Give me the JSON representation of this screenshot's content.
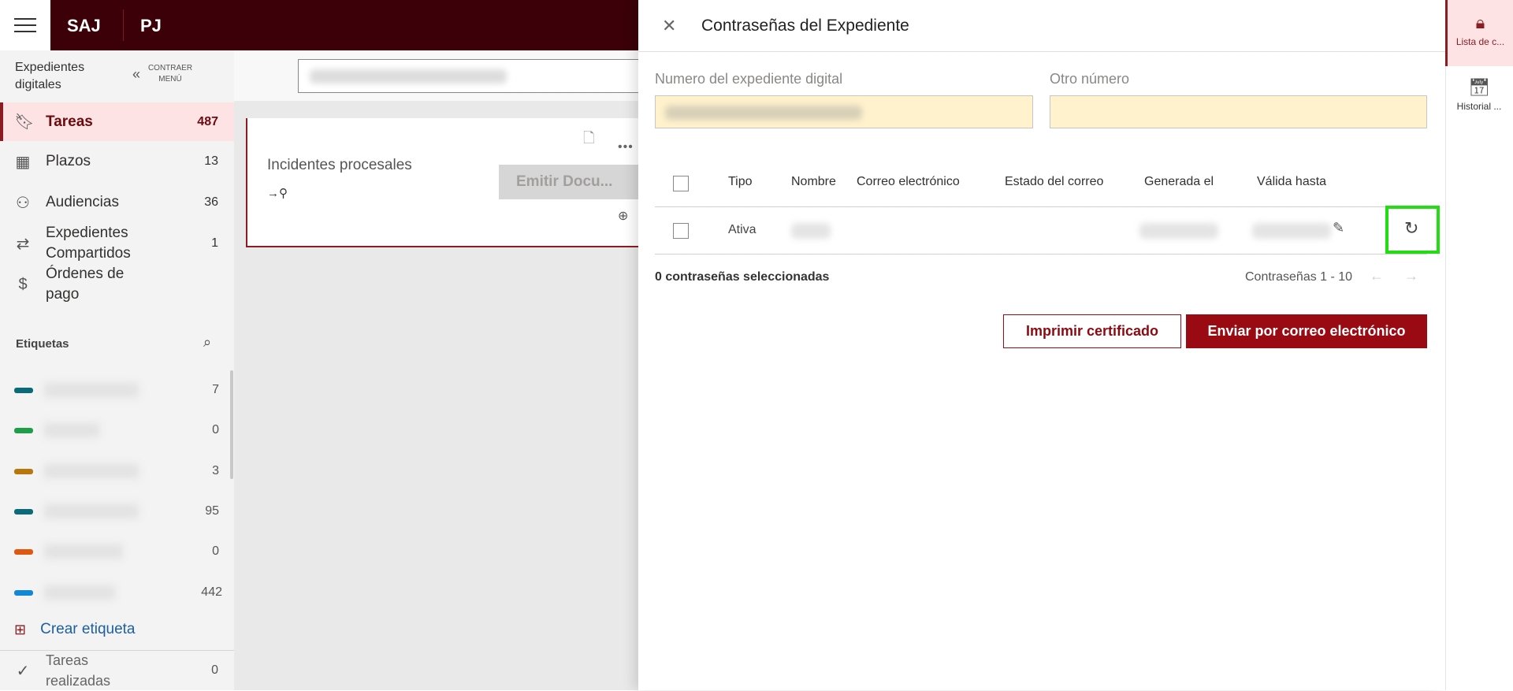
{
  "header": {
    "brand": "SAJ",
    "sub_brand": "PJ"
  },
  "sidebar": {
    "title": "Expedientes digitales",
    "collapse_label": "CONTRAER MENÚ",
    "items": [
      {
        "label": "Tareas",
        "count": "487",
        "icon": "bookmark-icon"
      },
      {
        "label": "Plazos",
        "count": "13",
        "icon": "calendar-icon"
      },
      {
        "label": "Audiencias",
        "count": "36",
        "icon": "people-icon"
      },
      {
        "label": "Expedientes Compartidos",
        "count": "1",
        "icon": "share-person-icon"
      },
      {
        "label": "Órdenes de pago",
        "count": "",
        "icon": "dollar-icon"
      }
    ],
    "tags_title": "Etiquetas",
    "tags": [
      {
        "color": "#0b6a7a",
        "count": "7"
      },
      {
        "color": "#1f9e4a",
        "count": "0"
      },
      {
        "color": "#b8760b",
        "count": "3"
      },
      {
        "color": "#0b6a7a",
        "count": "95"
      },
      {
        "color": "#e0570f",
        "count": "0"
      },
      {
        "color": "#1187d8",
        "count": "442"
      }
    ],
    "create_tag": "Crear etiqueta",
    "done_label": "Tareas realizadas",
    "done_count": "0"
  },
  "card": {
    "title": "Incidentes procesales",
    "emit_button": "Emitir Docu..."
  },
  "panel": {
    "title": "Contraseñas del Expediente",
    "field1_label": "Numero del expediente digital",
    "field2_label": "Otro número",
    "columns": [
      "Tipo",
      "Nombre",
      "Correo electrónico",
      "Estado del correo",
      "Generada el",
      "Válida hasta"
    ],
    "rows": [
      {
        "tipo": "Ativa"
      }
    ],
    "selected_text": "0 contraseñas seleccionadas",
    "pagination": "Contraseñas 1 - 10",
    "print_button": "Imprimir certificado",
    "send_button": "Enviar por correo electrónico"
  },
  "rail": {
    "items": [
      {
        "label": "Lista de c..."
      },
      {
        "label": "Historial ..."
      }
    ]
  },
  "colors": {
    "brand": "#3b0008",
    "accent": "#990a12",
    "highlight": "#22dd11"
  }
}
